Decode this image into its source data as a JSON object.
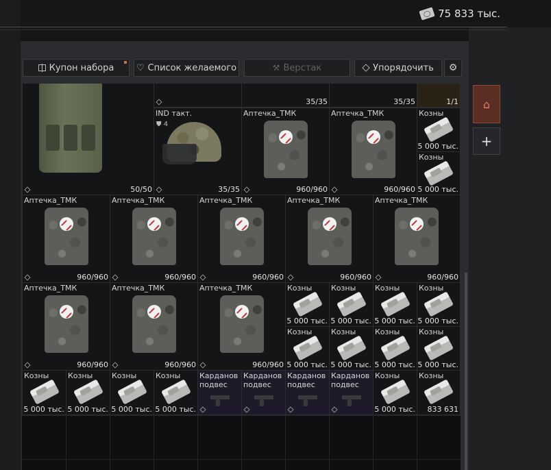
{
  "header": {
    "money_value": "75 833 тыс.",
    "money_icon": "money-bundle-icon"
  },
  "toolbar": {
    "coupon_label": "Купон набора",
    "wishlist_label": "Список желаемого",
    "workbench_label": "Верстак",
    "sort_label": "Упорядочить"
  },
  "items": {
    "medkit": "Аптечка_ТМК",
    "cash": "Козны",
    "helmet": "IND такт.",
    "gimbal_line1": "Карданов",
    "gimbal_line2": "подвес",
    "armor_level": "4"
  },
  "counts": {
    "c35": "35/35",
    "c11": "1/1",
    "c5050": "50/50",
    "c960": "960/960",
    "cash5000": "5 000 тыс.",
    "cash_last": "833 631"
  },
  "sidebar": {
    "home_icon": "home-icon",
    "add_icon": "plus-icon"
  }
}
